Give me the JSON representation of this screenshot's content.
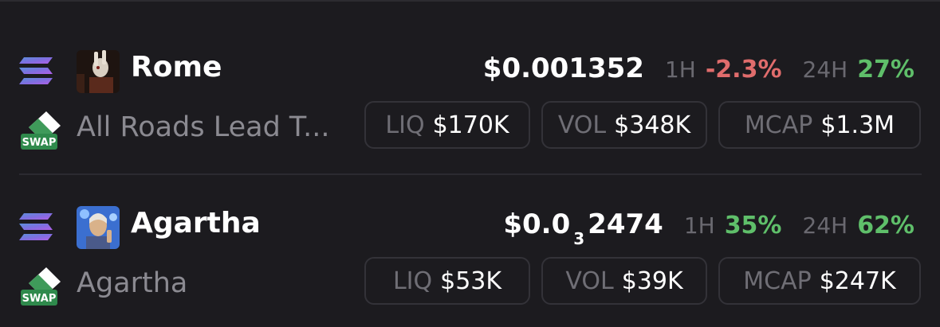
{
  "colors": {
    "background": "#1c1b1f",
    "positive": "#5fbf6a",
    "negative": "#e06c6c",
    "muted_text": "#8b8a91",
    "pill_border": "#333238"
  },
  "tokens": [
    {
      "name": "Rome",
      "full_name": "All Roads Lead T...",
      "chain_icon": "solana-icon",
      "swap_icon": "swap-icon",
      "price_prefix": "$0.001352",
      "price_subscript": "",
      "price_suffix": "",
      "change_1h_label": "1H",
      "change_1h": "-2.3%",
      "change_1h_direction": "negative",
      "change_24h_label": "24H",
      "change_24h": "27%",
      "change_24h_direction": "positive",
      "liq_label": "LIQ",
      "liq": "$170K",
      "vol_label": "VOL",
      "vol": "$348K",
      "mcap_label": "MCAP",
      "mcap": "$1.3M"
    },
    {
      "name": "Agartha",
      "full_name": "Agartha",
      "chain_icon": "solana-icon",
      "swap_icon": "swap-icon",
      "price_prefix": "$0.0",
      "price_subscript": "3",
      "price_suffix": "2474",
      "change_1h_label": "1H",
      "change_1h": "35%",
      "change_1h_direction": "positive",
      "change_24h_label": "24H",
      "change_24h": "62%",
      "change_24h_direction": "positive",
      "liq_label": "LIQ",
      "liq": "$53K",
      "vol_label": "VOL",
      "vol": "$39K",
      "mcap_label": "MCAP",
      "mcap": "$247K"
    }
  ]
}
